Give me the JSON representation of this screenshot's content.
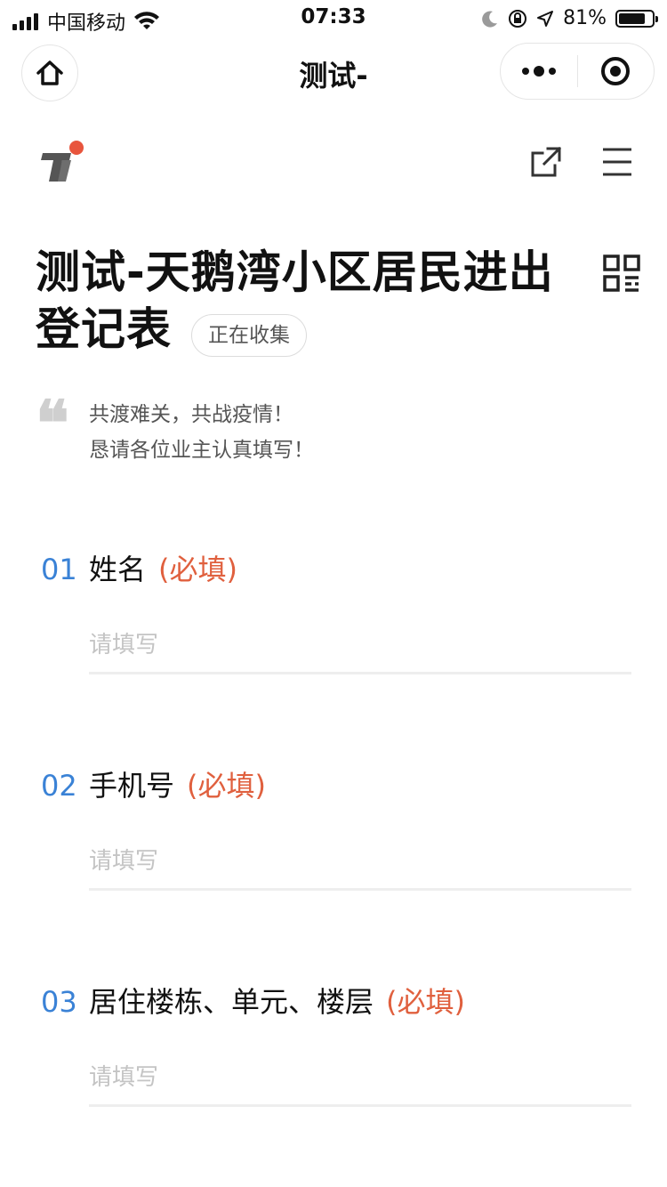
{
  "status_bar": {
    "carrier": "中国移动",
    "time": "07:33",
    "battery": "81%",
    "battery_level": 0.81
  },
  "mini_nav": {
    "title": "测试-"
  },
  "form": {
    "title": "测试-天鹅湾小区居民进出登记表",
    "status_badge": "正在收集",
    "quote_line1": "共渡难关，共战疫情！",
    "quote_line2": "恳请各位业主认真填写！"
  },
  "questions": [
    {
      "number": "01",
      "label": "姓名",
      "required": "(必填)",
      "placeholder": "请填写"
    },
    {
      "number": "02",
      "label": "手机号",
      "required": "(必填)",
      "placeholder": "请填写"
    },
    {
      "number": "03",
      "label": "居住楼栋、单元、楼层",
      "required": "(必填)",
      "placeholder": "请填写"
    }
  ],
  "colors": {
    "accent_number": "#3a82d6",
    "required": "#e0603e",
    "logo_dot": "#e8553d",
    "logo_gray": "#555555"
  },
  "icons": [
    "signal-icon",
    "wifi-icon",
    "moon-icon",
    "lock-rotation-icon",
    "location-icon",
    "battery-icon",
    "home-icon",
    "more-icon",
    "close-target-icon",
    "share-icon",
    "menu-icon",
    "qr-code-icon",
    "quote-icon"
  ]
}
